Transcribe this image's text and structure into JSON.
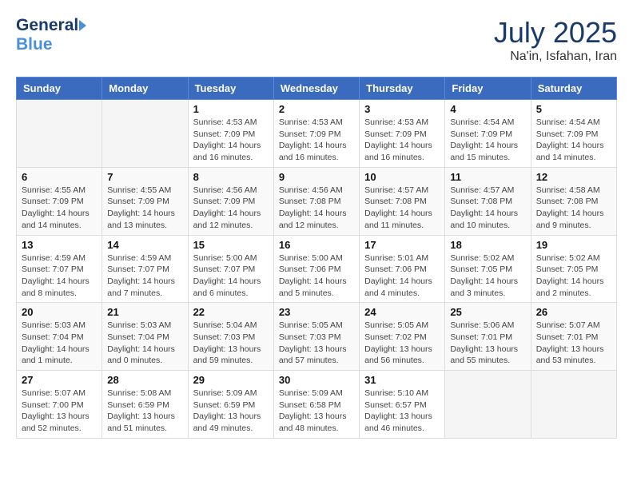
{
  "header": {
    "logo_general": "General",
    "logo_blue": "Blue",
    "month_title": "July 2025",
    "location": "Na'in, Isfahan, Iran"
  },
  "weekdays": [
    "Sunday",
    "Monday",
    "Tuesday",
    "Wednesday",
    "Thursday",
    "Friday",
    "Saturday"
  ],
  "weeks": [
    [
      {
        "day": "",
        "info": ""
      },
      {
        "day": "",
        "info": ""
      },
      {
        "day": "1",
        "info": "Sunrise: 4:53 AM\nSunset: 7:09 PM\nDaylight: 14 hours and 16 minutes."
      },
      {
        "day": "2",
        "info": "Sunrise: 4:53 AM\nSunset: 7:09 PM\nDaylight: 14 hours and 16 minutes."
      },
      {
        "day": "3",
        "info": "Sunrise: 4:53 AM\nSunset: 7:09 PM\nDaylight: 14 hours and 16 minutes."
      },
      {
        "day": "4",
        "info": "Sunrise: 4:54 AM\nSunset: 7:09 PM\nDaylight: 14 hours and 15 minutes."
      },
      {
        "day": "5",
        "info": "Sunrise: 4:54 AM\nSunset: 7:09 PM\nDaylight: 14 hours and 14 minutes."
      }
    ],
    [
      {
        "day": "6",
        "info": "Sunrise: 4:55 AM\nSunset: 7:09 PM\nDaylight: 14 hours and 14 minutes."
      },
      {
        "day": "7",
        "info": "Sunrise: 4:55 AM\nSunset: 7:09 PM\nDaylight: 14 hours and 13 minutes."
      },
      {
        "day": "8",
        "info": "Sunrise: 4:56 AM\nSunset: 7:09 PM\nDaylight: 14 hours and 12 minutes."
      },
      {
        "day": "9",
        "info": "Sunrise: 4:56 AM\nSunset: 7:08 PM\nDaylight: 14 hours and 12 minutes."
      },
      {
        "day": "10",
        "info": "Sunrise: 4:57 AM\nSunset: 7:08 PM\nDaylight: 14 hours and 11 minutes."
      },
      {
        "day": "11",
        "info": "Sunrise: 4:57 AM\nSunset: 7:08 PM\nDaylight: 14 hours and 10 minutes."
      },
      {
        "day": "12",
        "info": "Sunrise: 4:58 AM\nSunset: 7:08 PM\nDaylight: 14 hours and 9 minutes."
      }
    ],
    [
      {
        "day": "13",
        "info": "Sunrise: 4:59 AM\nSunset: 7:07 PM\nDaylight: 14 hours and 8 minutes."
      },
      {
        "day": "14",
        "info": "Sunrise: 4:59 AM\nSunset: 7:07 PM\nDaylight: 14 hours and 7 minutes."
      },
      {
        "day": "15",
        "info": "Sunrise: 5:00 AM\nSunset: 7:07 PM\nDaylight: 14 hours and 6 minutes."
      },
      {
        "day": "16",
        "info": "Sunrise: 5:00 AM\nSunset: 7:06 PM\nDaylight: 14 hours and 5 minutes."
      },
      {
        "day": "17",
        "info": "Sunrise: 5:01 AM\nSunset: 7:06 PM\nDaylight: 14 hours and 4 minutes."
      },
      {
        "day": "18",
        "info": "Sunrise: 5:02 AM\nSunset: 7:05 PM\nDaylight: 14 hours and 3 minutes."
      },
      {
        "day": "19",
        "info": "Sunrise: 5:02 AM\nSunset: 7:05 PM\nDaylight: 14 hours and 2 minutes."
      }
    ],
    [
      {
        "day": "20",
        "info": "Sunrise: 5:03 AM\nSunset: 7:04 PM\nDaylight: 14 hours and 1 minute."
      },
      {
        "day": "21",
        "info": "Sunrise: 5:03 AM\nSunset: 7:04 PM\nDaylight: 14 hours and 0 minutes."
      },
      {
        "day": "22",
        "info": "Sunrise: 5:04 AM\nSunset: 7:03 PM\nDaylight: 13 hours and 59 minutes."
      },
      {
        "day": "23",
        "info": "Sunrise: 5:05 AM\nSunset: 7:03 PM\nDaylight: 13 hours and 57 minutes."
      },
      {
        "day": "24",
        "info": "Sunrise: 5:05 AM\nSunset: 7:02 PM\nDaylight: 13 hours and 56 minutes."
      },
      {
        "day": "25",
        "info": "Sunrise: 5:06 AM\nSunset: 7:01 PM\nDaylight: 13 hours and 55 minutes."
      },
      {
        "day": "26",
        "info": "Sunrise: 5:07 AM\nSunset: 7:01 PM\nDaylight: 13 hours and 53 minutes."
      }
    ],
    [
      {
        "day": "27",
        "info": "Sunrise: 5:07 AM\nSunset: 7:00 PM\nDaylight: 13 hours and 52 minutes."
      },
      {
        "day": "28",
        "info": "Sunrise: 5:08 AM\nSunset: 6:59 PM\nDaylight: 13 hours and 51 minutes."
      },
      {
        "day": "29",
        "info": "Sunrise: 5:09 AM\nSunset: 6:59 PM\nDaylight: 13 hours and 49 minutes."
      },
      {
        "day": "30",
        "info": "Sunrise: 5:09 AM\nSunset: 6:58 PM\nDaylight: 13 hours and 48 minutes."
      },
      {
        "day": "31",
        "info": "Sunrise: 5:10 AM\nSunset: 6:57 PM\nDaylight: 13 hours and 46 minutes."
      },
      {
        "day": "",
        "info": ""
      },
      {
        "day": "",
        "info": ""
      }
    ]
  ]
}
